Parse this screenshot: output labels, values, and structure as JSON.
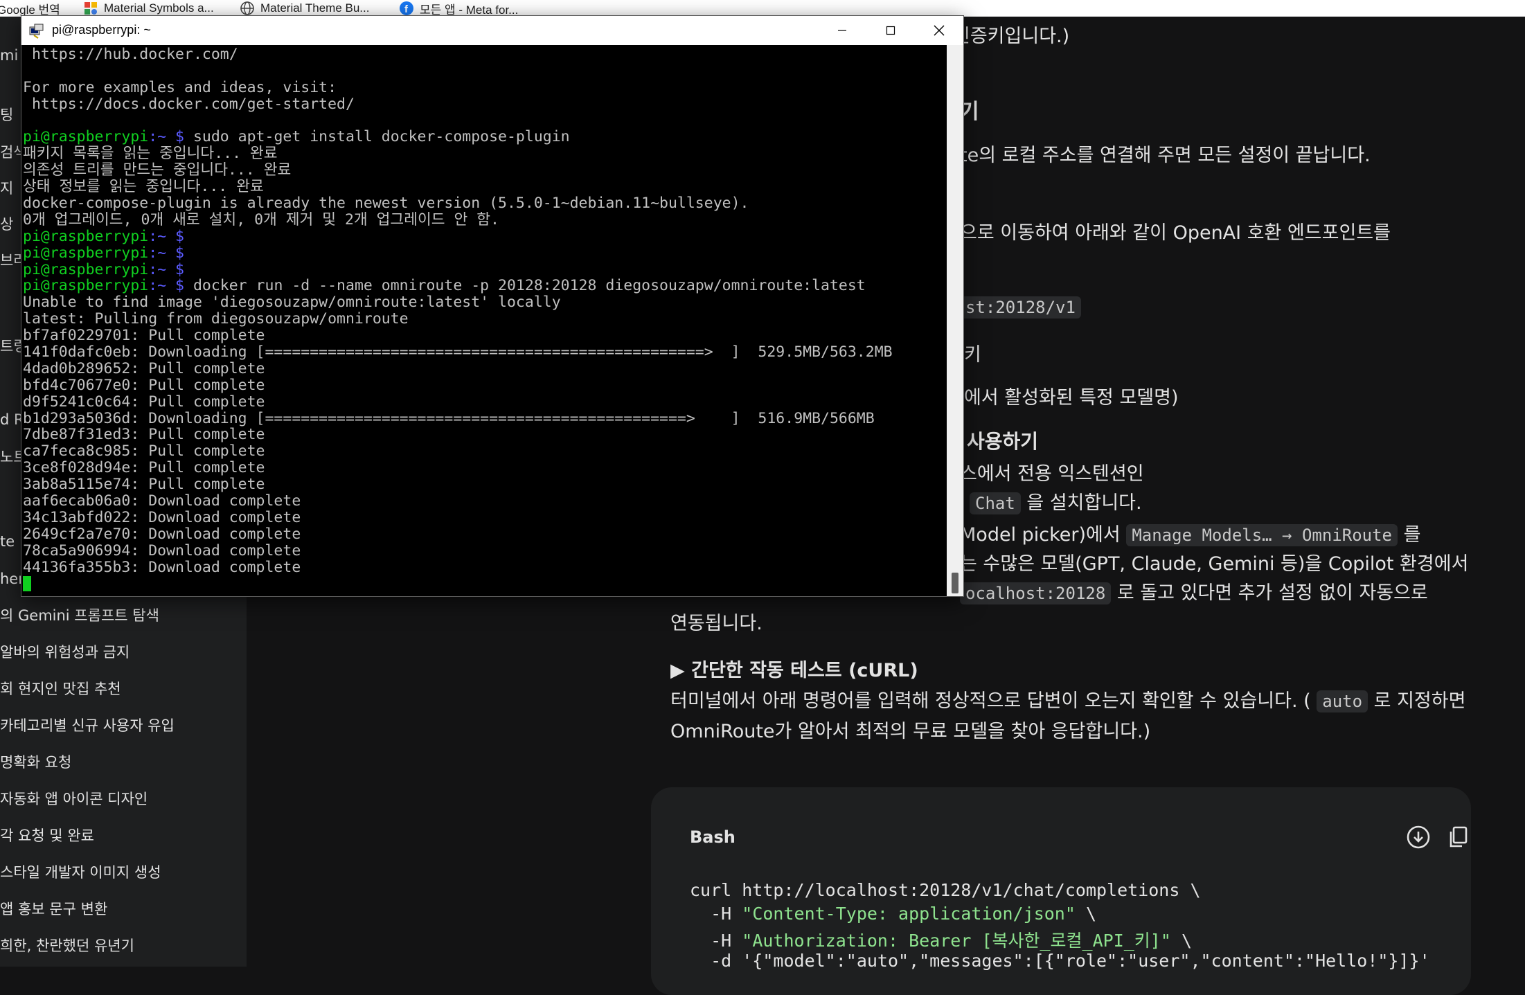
{
  "bookmarks": [
    {
      "label": "Google 번역",
      "icon": "google-translate-icon"
    },
    {
      "label": "Material Symbols a...",
      "icon": "material-symbols-icon"
    },
    {
      "label": "Material Theme Bu...",
      "icon": "globe-icon"
    },
    {
      "label": "모든 앱 - Meta for...",
      "icon": "facebook-icon"
    }
  ],
  "sidebar": {
    "fragments": [
      "mi",
      "팅",
      "검색",
      "지",
      "상",
      "브라",
      "트링",
      "d R",
      "노트",
      "te",
      "her"
    ],
    "items": [
      "의 Gemini 프롬프트 탐색",
      "알바의 위험성과 금지",
      "회 현지인 맛집 추천",
      "카테고리별 신규 사용자 유입",
      "명확화 요청",
      "자동화 앱 아이콘 디자인",
      "각 요청 및 완료",
      "스타일 개발자 이미지 생성",
      "앱 홍보 문구 변환",
      "희한, 찬란했던 유년기"
    ]
  },
  "article": {
    "l1": "인증키입니다.)",
    "h1": "기",
    "l2": "te의 로컬 주소를 연결해 주면 모든 설정이 끝납니다.",
    "l3": "으로 이동하여 아래와 같이 OpenAI 호환 엔드포인트를",
    "code1": "st:20128/v1",
    "l4": "키",
    "l5": "에서 활성화된 특정 모델명)",
    "h2": "사용하기",
    "l6": "스에서 전용 익스텐션인",
    "code2": "Chat",
    "l7_suffix": "을 설치합니다.",
    "l8_prefix": "Model picker)에서",
    "code3": "Manage Models… → OmniRoute",
    "l8_suffix": "를",
    "l9": "는 수많은 모델(GPT, Claude, Gemini 등)을 Copilot 환경에서",
    "code4": "ocalhost:20128",
    "l10_suffix": "로 돌고 있다면 추가 설정 없이 자동으로",
    "l11": "연동됩니다.",
    "h3": "▶ 간단한 작동 테스트 (cURL)",
    "l12_prefix": "터미널에서 아래 명령어를 입력해 정상적으로 답변이 오는지 확인할 수 있습니다. (",
    "code5": "auto",
    "l12_suffix": "로 지정하면",
    "l13": "OmniRoute가 알아서 최적의 무료 모델을 찾아 응답합니다.)"
  },
  "code_block": {
    "language": "Bash",
    "lines": [
      "curl http://localhost:20128/v1/chat/completions \\",
      "  -H ",
      "  -H "
    ],
    "strings": [
      "\"Content-Type: application/json\"",
      "\"Authorization: Bearer [복사한_로컬_API_키]\""
    ],
    "tails": [
      " \\",
      " \\"
    ],
    "last_partial": "  -d '{\"model\":\"auto\",\"messages\":[{\"role\":\"user\",\"content\":\"Hello!\"}]}'"
  },
  "terminal": {
    "title": "pi@raspberrypi: ~",
    "prompt_user": "pi@raspberrypi",
    "prompt_path": ":~ $",
    "lines": [
      {
        "t": " https://hub.docker.com/"
      },
      {
        "t": ""
      },
      {
        "t": "For more examples and ideas, visit:"
      },
      {
        "t": " https://docs.docker.com/get-started/"
      },
      {
        "t": ""
      },
      {
        "p": true,
        "t": " sudo apt-get install docker-compose-plugin"
      },
      {
        "t": "패키지 목록을 읽는 중입니다... 완료"
      },
      {
        "t": "의존성 트리를 만드는 중입니다... 완료"
      },
      {
        "t": "상태 정보를 읽는 중입니다... 완료"
      },
      {
        "t": "docker-compose-plugin is already the newest version (5.5.0-1~debian.11~bullseye)."
      },
      {
        "t": "0개 업그레이드, 0개 새로 설치, 0개 제거 및 2개 업그레이드 안 함."
      },
      {
        "p": true,
        "t": ""
      },
      {
        "p": true,
        "t": ""
      },
      {
        "p": true,
        "t": ""
      },
      {
        "p": true,
        "t": " docker run -d --name omniroute -p 20128:20128 diegosouzapw/omniroute:latest"
      },
      {
        "t": "Unable to find image 'diegosouzapw/omniroute:latest' locally"
      },
      {
        "t": "latest: Pulling from diegosouzapw/omniroute"
      },
      {
        "t": "bf7af0229701: Pull complete"
      },
      {
        "t": "141f0dafc0eb: Downloading [=================================================>  ]  529.5MB/563.2MB"
      },
      {
        "t": "4dad0b289652: Pull complete"
      },
      {
        "t": "bfd4c70677e0: Pull complete"
      },
      {
        "t": "d9f5241c0c64: Pull complete"
      },
      {
        "t": "b1d293a5036d: Downloading [===============================================>    ]  516.9MB/566MB"
      },
      {
        "t": "7dbe87f31ed3: Pull complete"
      },
      {
        "t": "ca7feca8c985: Pull complete"
      },
      {
        "t": "3ce8f028d94e: Pull complete"
      },
      {
        "t": "3ab8a5115e74: Pull complete"
      },
      {
        "t": "aaf6ecab06a0: Download complete"
      },
      {
        "t": "34c13abfd022: Download complete"
      },
      {
        "t": "2649cf2a7e70: Download complete"
      },
      {
        "t": "78ca5a906994: Download complete"
      },
      {
        "t": "44136fa355b3: Download complete"
      }
    ]
  }
}
